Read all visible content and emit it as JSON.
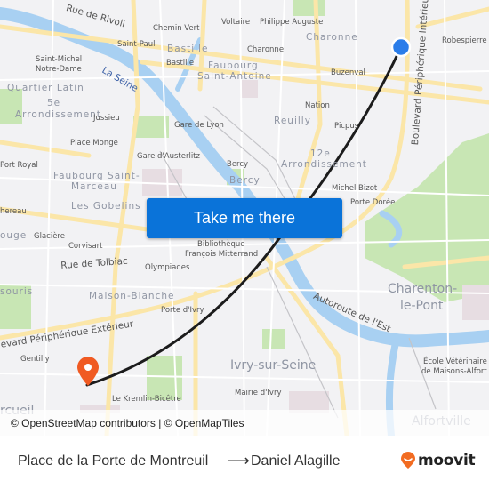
{
  "map": {
    "labels": {
      "rue_de_rivoli": "Rue de Rivoli",
      "chemin_vert": "Chemin Vert",
      "voltaire": "Voltaire",
      "philippe_auguste": "Philippe Auguste",
      "saint_paul": "Saint-Paul",
      "bastille_district": "Bastille",
      "bastille_station": "Bastille",
      "charonne_district": "Charonne",
      "charonne_station": "Charonne",
      "robespierre": "Robespierre",
      "saint_michel": "Saint-Michel",
      "notre_dame": "Notre-Dame",
      "la_seine": "La Seine",
      "faubourg_1": "Faubourg",
      "faubourg_2": "Saint-Antoine",
      "buzenval": "Buzenval",
      "quartier_latin": "Quartier Latin",
      "arr5_1": "5e",
      "arr5_2": "Arrondissement",
      "jussieu": "Jussieu",
      "nation": "Nation",
      "reuilly": "Reuilly",
      "gare_de_lyon": "Gare de Lyon",
      "picpus": "Picpus",
      "place_monge": "Place Monge",
      "gare_austerlitz": "Gare d'Austerlitz",
      "port_royal": "Port Royal",
      "bercy_station": "Bercy",
      "bercy_district": "Bercy",
      "arr12_1": "12e",
      "arr12_2": "Arrondissement",
      "fbg_st_marceau_1": "Faubourg Saint-",
      "fbg_st_marceau_2": "Marceau",
      "michel_bizot": "Michel Bizot",
      "porte_doree": "Porte Dorée",
      "gobelins": "Les Gobelins",
      "chereau": "hereau",
      "glaciere": "Glacière",
      "corvisart": "Corvisart",
      "rouge": "ouge",
      "bibliotheque_1": "Bibliothèque",
      "bibliotheque_2": "François Mitterrand",
      "rue_de_tolbiac": "Rue de Tolbiac",
      "olympiades": "Olympiades",
      "montsouris": "souris",
      "maison_blanche": "Maison-Blanche",
      "charenton_1": "Charenton-",
      "charenton_2": "le-Pont",
      "porte_divry": "Porte d'Ivry",
      "autoroute_est": "Autoroute de l'Est",
      "periph_ext": "evard Périphérique Extérieur",
      "periph_int": "Boulevard Périphérique Intérieur",
      "ivry": "Ivry-sur-Seine",
      "gentilly": "Gentilly",
      "ecole_vet_1": "École Vétérinaire",
      "ecole_vet_2": "de Maisons-Alfort",
      "mairie_ivry": "Mairie d'Ivry",
      "kremlin": "Le Kremlin-Bicêtre",
      "arcueil": "rcueil",
      "alfortville": "Alfortville"
    },
    "colors": {
      "background": "#f2f2f4",
      "road": "#fbe6a8",
      "water": "#a8d0f2",
      "park": "#c8e6b4",
      "route_line": "#1c1c1c",
      "origin_marker": "#2b7de9",
      "destination_marker": "#f05a22"
    },
    "cta_label": "Take me there",
    "attribution": "© OpenStreetMap contributors | © OpenMapTiles"
  },
  "footer": {
    "from": "Place de la Porte de Montreuil",
    "arrow": "⟶",
    "to": "Daniel Alagille",
    "brand": "moovit",
    "brand_color": "#f26c22"
  }
}
